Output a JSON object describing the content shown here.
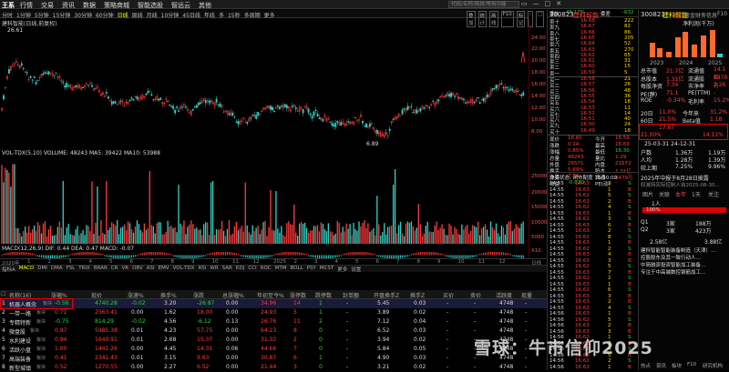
{
  "menubar": {
    "logo": "王系",
    "items": [
      "行情",
      "交易",
      "资讯",
      "数据",
      "策略商城",
      "智能选股",
      "智远云",
      "其他"
    ],
    "search_placeholder": "代码/名称/简拼/常用功能",
    "window_controls": [
      "▭",
      "—",
      "□",
      "✕"
    ]
  },
  "periodbar": {
    "items": [
      "分时",
      "1分钟",
      "5分钟",
      "15分钟",
      "30分钟",
      "60分钟",
      "日线",
      "周线",
      "月线",
      "10分钟",
      "45日线",
      "年线",
      "多",
      "15秒",
      "多周期",
      "更多"
    ],
    "active": "日线",
    "right_buttons": [
      "叠加",
      "统计",
      "画线",
      "F10",
      "标记",
      "-",
      "□"
    ]
  },
  "stockline": "建科智能(日线,前复权)",
  "kchart": {
    "high_label": "26.61",
    "low_label": "6.89"
  },
  "vol": {
    "label": "VOL-TDX(5,10) VOLUME: 48243 MA5: 39422 MA10: 53988"
  },
  "macd": {
    "label": "MACD(12,26,9) DIF: 0.44 DEA: 0.47 MACD: -0.07"
  },
  "yaxis": [
    "24.00",
    "22.00",
    "20.00",
    "18.00",
    "16.00",
    "14.00",
    "12.00",
    "10.00",
    "8.00",
    "25000",
    "20000",
    "15000",
    "10000",
    "5000",
    "X10"
  ],
  "datebar": {
    "start": "2020年",
    "labels": [
      "1",
      "2",
      "3",
      "4",
      "5",
      "6",
      "7",
      "8",
      "9",
      "10",
      "11",
      "12",
      "2025",
      "2",
      "3",
      "4",
      "5",
      "6",
      "7",
      "8",
      "9",
      "10",
      "11",
      "12"
    ],
    "right": "日线"
  },
  "indicators": [
    "指标A",
    "MACD",
    "DMI",
    "DMA",
    "FSL",
    "TRIX",
    "BRAR",
    "CR",
    "VR",
    "OBV",
    "ASI",
    "EMV",
    "VOL-TDX",
    "RSI",
    "WR",
    "SAR",
    "KDJ",
    "CCI",
    "ROC",
    "MTM",
    "BOLL",
    "PSY",
    "MCST",
    "更多",
    "设置"
  ],
  "table": {
    "headers": [
      "名称(16)",
      "涨幅%",
      "现价",
      "涨速%",
      "换手%",
      "涨跌",
      "总涨幅%",
      "年初至今%",
      "涨停数",
      "跌停数",
      "封单额",
      "开盘换手Z",
      "换手Z",
      "买价",
      "卖价",
      "活跃度",
      "现量"
    ],
    "rows": [
      {
        "idx": "1",
        "name": "机器人概念",
        "tag": "板块",
        "chg": "-0.56",
        "price": "4740.28",
        "speed": "-0.02",
        "turnover": "3.20",
        "diff": "-26.87",
        "total": "0.00",
        "ytd": "34.96",
        "up": "14",
        "down": "1",
        "seal": "-",
        "open": "5.45",
        "turnz": "0.03",
        "buy": "-",
        "sell": "-",
        "active": "4748",
        "vol": "-"
      },
      {
        "idx": "2",
        "name": "一带一路",
        "tag": "板块",
        "chg": "0.71",
        "price": "2563.41",
        "speed": "0.00",
        "turnover": "1.62",
        "diff": "18.00",
        "total": "0.00",
        "ytd": "24.93",
        "up": "5",
        "down": "1",
        "seal": "-",
        "open": "3.89",
        "turnz": "0.02",
        "buy": "-",
        "sell": "-",
        "active": "4748",
        "vol": "-"
      },
      {
        "idx": "3",
        "name": "专精特新",
        "tag": "板块",
        "chg": "-0.75",
        "price": "814.29",
        "speed": "-0.02",
        "turnover": "4.56",
        "diff": "-6.12",
        "total": "0.13",
        "ytd": "26.76",
        "up": "11",
        "down": "2",
        "seal": "-",
        "open": "7.12",
        "turnz": "0.04",
        "buy": "-",
        "sell": "-",
        "active": "4748",
        "vol": "-"
      },
      {
        "idx": "4",
        "name": "微盘股",
        "tag": "板块",
        "chg": "0.97",
        "price": "5985.38",
        "speed": "0.01",
        "turnover": "4.23",
        "diff": "57.75",
        "total": "0.00",
        "ytd": "64.23",
        "up": "8",
        "down": "0",
        "seal": "-",
        "open": "6.52",
        "turnz": "0.03",
        "buy": "-",
        "sell": "-",
        "active": "4748",
        "vol": "-"
      },
      {
        "idx": "5",
        "name": "水利建设",
        "tag": "板块",
        "chg": "0.94",
        "price": "1649.91",
        "speed": "0.01",
        "turnover": "2.68",
        "diff": "15.37",
        "total": "0.00",
        "ytd": "31.32",
        "up": "2",
        "down": "0",
        "seal": "-",
        "open": "3.94",
        "turnz": "0.02",
        "buy": "-",
        "sell": "-",
        "active": "4748",
        "vol": "-"
      },
      {
        "idx": "6",
        "name": "活跃小盘",
        "tag": "板块",
        "chg": "1.00",
        "price": "1441.26",
        "speed": "0.00",
        "turnover": "4.45",
        "diff": "14.31",
        "total": "0.06",
        "ytd": "44.66",
        "up": "7",
        "down": "0",
        "seal": "-",
        "open": "5.84",
        "turnz": "0.05",
        "buy": "-",
        "sell": "-",
        "active": "4748",
        "vol": "-"
      },
      {
        "idx": "7",
        "name": "高端装备",
        "tag": "板块",
        "chg": "0.41",
        "price": "2341.43",
        "speed": "0.01",
        "turnover": "3.15",
        "diff": "9.63",
        "total": "0.00",
        "ytd": "30.87",
        "up": "6",
        "down": "1",
        "seal": "-",
        "open": "4.90",
        "turnz": "0.03",
        "buy": "-",
        "sell": "-",
        "active": "4748",
        "vol": "-"
      },
      {
        "idx": "8",
        "name": "新型城镇",
        "tag": "板块",
        "chg": "0.52",
        "price": "1270.55",
        "speed": "0.00",
        "turnover": "2.27",
        "diff": "6.52",
        "total": "0.00",
        "ytd": "21.44",
        "up": "3",
        "down": "0",
        "seal": "-",
        "open": "3.21",
        "turnz": "0.02",
        "buy": "-",
        "sell": "-",
        "active": "4748",
        "vol": "-"
      }
    ]
  },
  "orderbook": {
    "header": {
      "wb_label": "委比",
      "wb": "-48.17%",
      "wc_label": "委差",
      "wc": "-632"
    },
    "sells": [
      {
        "l": "卖十",
        "p": "16.68",
        "v": "222"
      },
      {
        "l": "卖九",
        "p": "16.67",
        "v": "82"
      },
      {
        "l": "卖八",
        "p": "16.66",
        "v": "86"
      },
      {
        "l": "卖七",
        "p": "16.65",
        "v": "205"
      },
      {
        "l": "卖六",
        "p": "16.64",
        "v": "52"
      },
      {
        "l": "卖五",
        "p": "16.63",
        "v": "270"
      },
      {
        "l": "卖四",
        "p": "16.62",
        "v": "65"
      },
      {
        "l": "卖三",
        "p": "16.61",
        "v": "31"
      },
      {
        "l": "卖二",
        "p": "16.60",
        "v": "15"
      },
      {
        "l": "卖一",
        "p": "16.59",
        "v": "5"
      }
    ],
    "buys": [
      {
        "l": "买一",
        "p": "16.58",
        "v": "21"
      },
      {
        "l": "买二",
        "p": "16.57",
        "v": "26"
      },
      {
        "l": "买三",
        "p": "16.56",
        "v": "48"
      },
      {
        "l": "买四",
        "p": "16.55",
        "v": "36"
      },
      {
        "l": "买五",
        "p": "16.54",
        "v": "18"
      },
      {
        "l": "买六",
        "p": "16.53",
        "v": "11"
      },
      {
        "l": "买七",
        "p": "16.52",
        "v": "14"
      },
      {
        "l": "买八",
        "p": "16.51",
        "v": "40"
      },
      {
        "l": "买九",
        "p": "16.50",
        "v": "24"
      },
      {
        "l": "买十",
        "p": "16.49",
        "v": "18"
      }
    ],
    "stats": [
      {
        "a": "现价",
        "b": "16.60",
        "c": "今开",
        "d": "16.59"
      },
      {
        "a": "涨跌",
        "b": "0.14",
        "c": "最高",
        "d": "16.69"
      },
      {
        "a": "涨幅",
        "b": "0.85%",
        "c": "最低",
        "d": "16.30"
      },
      {
        "a": "总量",
        "b": "48243",
        "c": "量比",
        "d": "1.29"
      },
      {
        "a": "外盘",
        "b": "26571",
        "c": "内盘",
        "d": "21672"
      },
      {
        "a": "换手",
        "b": "5.69%",
        "c": "股本",
        "d": "1.31亿"
      },
      {
        "a": "净资",
        "b": "7.34",
        "c": "流通",
        "d": "8479万"
      },
      {
        "a": "收益",
        "b": "-0.020",
        "c": "PE(动)",
        "d": "-"
      }
    ]
  },
  "quote": {
    "header": "交易状态: 闭市配度 15:30:00",
    "ticks": [
      [
        "14:55",
        "16.63",
        "3",
        "S"
      ],
      [
        "14:55",
        "16.63",
        "1",
        "B"
      ],
      [
        "14:55",
        "16.62",
        "5",
        "S"
      ],
      [
        "14:55",
        "16.63",
        "2",
        "B"
      ],
      [
        "14:55",
        "16.62",
        "4",
        "S"
      ],
      [
        "14:55",
        "16.63",
        "1",
        "B"
      ],
      [
        "14:55",
        "16.62",
        "3",
        "S"
      ],
      [
        "14:55",
        "16.63",
        "6",
        "B"
      ],
      [
        "14:55",
        "16.63",
        "2",
        "S"
      ],
      [
        "14:55",
        "16.62",
        "8",
        "S"
      ],
      [
        "14:55",
        "16.63",
        "1",
        "B"
      ],
      [
        "14:55",
        "16.62",
        "2",
        "S"
      ],
      [
        "14:55",
        "16.63",
        "4",
        "B"
      ],
      [
        "14:55",
        "16.63",
        "3",
        "B"
      ],
      [
        "14:55",
        "16.62",
        "5",
        "S"
      ],
      [
        "14:55",
        "16.63",
        "7",
        "B"
      ],
      [
        "14:55",
        "16.62",
        "2",
        "S"
      ],
      [
        "14:55",
        "16.63",
        "1",
        "B"
      ],
      [
        "14:55",
        "16.62",
        "6",
        "S"
      ],
      [
        "14:55",
        "16.63",
        "3",
        "B"
      ],
      [
        "14:55",
        "16.63",
        "2",
        "B"
      ],
      [
        "14:55",
        "16.62",
        "4",
        "S"
      ],
      [
        "14:56",
        "16.63",
        "1",
        "B"
      ],
      [
        "14:56",
        "16.62",
        "5",
        "S"
      ],
      [
        "14:56",
        "16.63",
        "2",
        "B"
      ],
      [
        "14:56",
        "16.63",
        "3",
        "B"
      ],
      [
        "14:56",
        "16.62",
        "1",
        "S"
      ],
      [
        "14:56",
        "16.63",
        "2",
        "B"
      ],
      [
        "14:56",
        "16.62",
        "4",
        "S"
      ],
      [
        "14:56",
        "16.63",
        "5",
        "B"
      ],
      [
        "14:56",
        "16.62",
        "2",
        "S"
      ],
      [
        "14:56",
        "16.63",
        "1",
        "B"
      ]
    ]
  },
  "panel": {
    "code": "300823",
    "name": "建科智能",
    "tabs": [
      "盘口",
      "资金",
      "财务",
      "信息",
      "F10"
    ],
    "chart_label": "净利润(千万)",
    "bar_years": [
      "2023",
      "2024",
      "2025"
    ],
    "fields": [
      {
        "k": "总市值",
        "v": "21.7亿"
      },
      {
        "k": "流通值",
        "v": "14.1亿"
      },
      {
        "k": "总股本",
        "v": "1.31亿"
      },
      {
        "k": "流通股",
        "v": "8479万"
      },
      {
        "k": "每股净资",
        "v": "7.34"
      },
      {
        "k": "市净率",
        "v": "2.26"
      },
      {
        "k": "PE(静)",
        "v": "71.1"
      },
      {
        "k": "PE(TTM)",
        "v": "-"
      },
      {
        "k": "ROE",
        "v": "-0.34%"
      },
      {
        "k": "毛利率",
        "v": "15.2%"
      }
    ],
    "ranges": [
      {
        "k": "20日",
        "v": "11.0%",
        "k2": "今年来",
        "v2": "31.2%"
      },
      {
        "k": "60日",
        "v": "21.5%",
        "k2": "Beta值",
        "v2": "1.18"
      }
    ],
    "peak": {
      "a": "17.67",
      "b": "21.00%",
      "c": "14.11%"
    },
    "dates": "25-03-31  24-12-31",
    "holders": [
      {
        "k": "户数",
        "v": "1.36万",
        "v2": "1.19万"
      },
      {
        "k": "人均",
        "v": "1.28万",
        "v2": "1.39万"
      },
      {
        "k": "较上期",
        "v": "7.25%",
        "v2": "9.96%"
      }
    ],
    "notice": "2025年中报于8月28日披露",
    "notice2": "权减持实际控制人自2025-08-30...",
    "tabs2": [
      "图片",
      "关联",
      "本年",
      "1天",
      "关注"
    ],
    "zone": "1人",
    "pct": "100%",
    "cells": [
      {
        "k": "Q1",
        "v": "3家",
        "v2": "188万"
      },
      {
        "k": "Q2",
        "v": "3家",
        "v2": "423万"
      }
    ],
    "cash": "2.58亿",
    "cash2": "3.88亿",
    "news": [
      "建科智能智能装备制造（天津）…",
      "控股股东及其一致行动人…",
      "中简融资投资智能加工装备…",
      "专注于中高端数控钢筋加工…"
    ],
    "bottom_tabs": [
      "热点",
      "资讯",
      "板块",
      "F10",
      "研究机构"
    ]
  },
  "watermark": "雪球：牛市信仰2025"
}
